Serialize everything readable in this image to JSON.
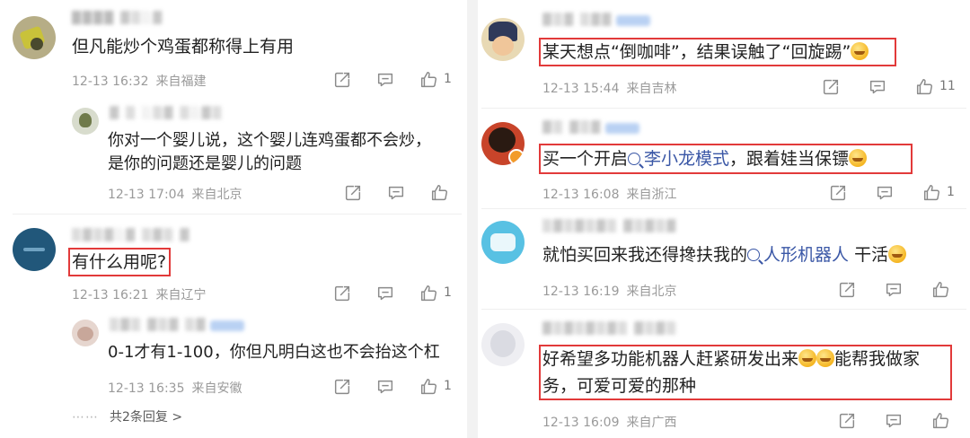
{
  "left": {
    "c1": {
      "username": "████ ▓▒░▓",
      "text": "但凡能炒个鸡蛋都称得上有用",
      "time": "12-13 16:32",
      "location": "来自福建",
      "likes": "1",
      "reply": {
        "username": "▓ ▒ ░▒▓ ▒░▓▒",
        "text_line1": "你对一个婴儿说，这个婴儿连鸡蛋都不会炒，",
        "text_line2": "是你的问题还是婴儿的问题",
        "time": "12-13 17:04",
        "location": "来自北京"
      }
    },
    "c2": {
      "username": "▒▓▒▓░▓ ▒▓▒ ▓",
      "text": "有什么用呢?",
      "time": "12-13 16:21",
      "location": "来自辽宁",
      "likes": "1",
      "reply": {
        "username": "▒▓▒ ▓▒▓ ▒▓",
        "text": "0-1才有1-100，你但凡明白这也不会抬这个杠",
        "time": "12-13 16:35",
        "location": "来自安徽",
        "likes": "1"
      },
      "more_replies": "共2条回复 >",
      "more_dots": "⋯⋯"
    }
  },
  "right": {
    "c1": {
      "username": "▓▒▓ ▒▓▓",
      "text_a": "某天想点“倒咖啡”，结果误触了“回旋踢”",
      "time": "12-13 15:44",
      "location": "来自吉林",
      "likes": "11"
    },
    "c2": {
      "username": "▓▒ ▓▒▓",
      "text_a": "买一个开启",
      "keyword": "李小龙模式",
      "text_b": "，跟着娃当保镖",
      "time": "12-13 16:08",
      "location": "来自浙江",
      "likes": "1"
    },
    "c3": {
      "username": "▒▓▒▓▒▓▒ ▓▒▓▒▓",
      "text_a": "就怕买回来我还得搀扶我的",
      "keyword": "人形机器人",
      "text_b": "干活",
      "time": "12-13 16:19",
      "location": "来自北京"
    },
    "c4": {
      "username": "▓▒▓▒▓▒▓▒ ▓▒▓▒",
      "text_line1a": "好希望多功能机器人赶紧研发出来",
      "text_line1b": "能帮我做家",
      "text_line2": "务，可爱可爱的那种",
      "time": "12-13 16:09",
      "location": "来自广西"
    }
  },
  "colors": {
    "highlight": "#e23a3a",
    "link": "#3a57a6",
    "meta": "#9a9a9a"
  },
  "icons": [
    "share-icon",
    "comment-icon",
    "like-icon",
    "search-keyword-icon",
    "emoji-icon"
  ]
}
